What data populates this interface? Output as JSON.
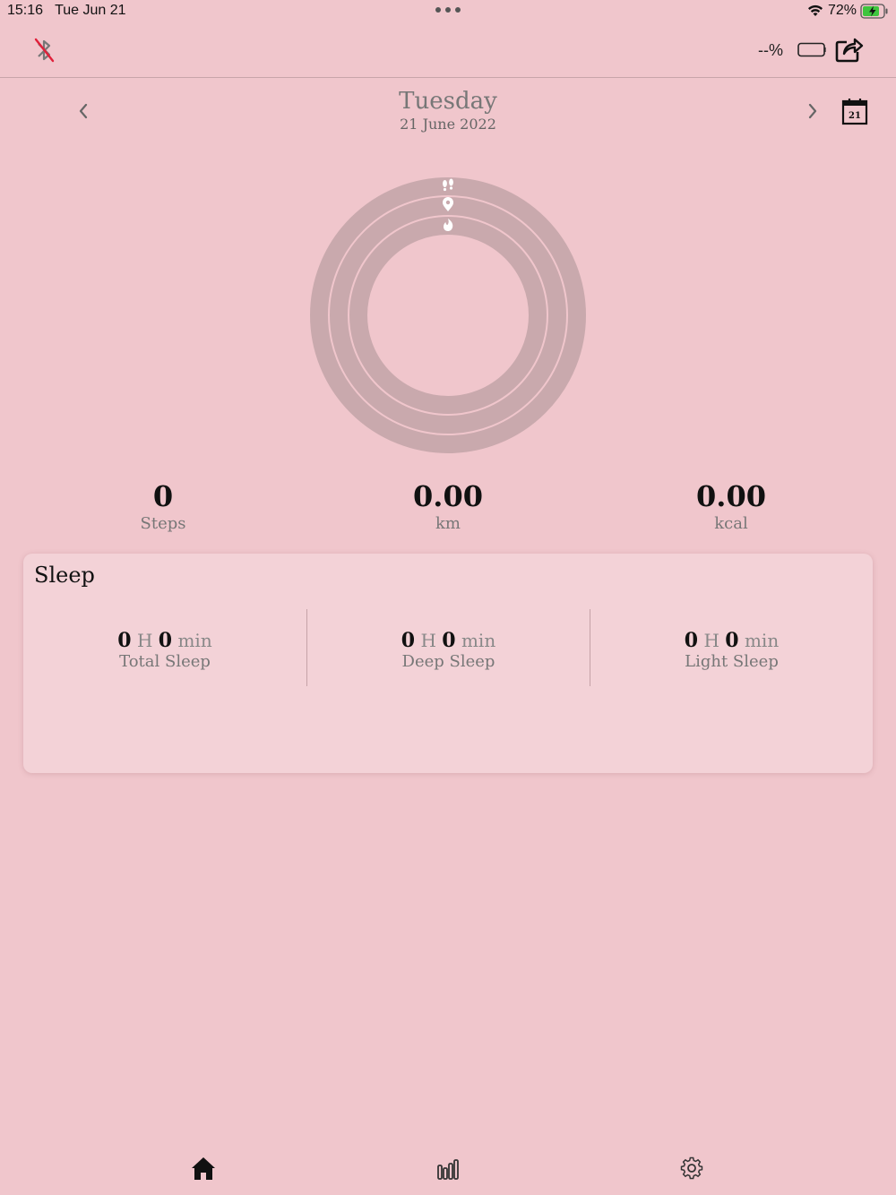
{
  "status_bar": {
    "time": "15:16",
    "date": "Tue Jun 21",
    "battery_pct": "72%"
  },
  "top_bar": {
    "device_battery_pct": "--%"
  },
  "date_nav": {
    "day_name": "Tuesday",
    "date_full": "21 June 2022",
    "calendar_day": "21"
  },
  "stats": {
    "steps": {
      "value": "0",
      "label": "Steps"
    },
    "distance": {
      "value": "0.00",
      "label": "km"
    },
    "calories": {
      "value": "0.00",
      "label": "kcal"
    }
  },
  "rings": {
    "steps_progress": 0,
    "distance_progress": 0,
    "calories_progress": 0
  },
  "sleep": {
    "title": "Sleep",
    "hours_unit": "H",
    "min_unit": "min",
    "total": {
      "hours": "0",
      "minutes": "0",
      "label": "Total Sleep"
    },
    "deep": {
      "hours": "0",
      "minutes": "0",
      "label": "Deep Sleep"
    },
    "light": {
      "hours": "0",
      "minutes": "0",
      "label": "Light Sleep"
    }
  },
  "tabs": [
    "home-icon",
    "stats-icon",
    "settings-icon"
  ],
  "colors": {
    "background": "#f0c6cc",
    "card": "#f3d2d7",
    "ring_track": "#c9a9ad",
    "bluetooth_off_slash": "#e0203a",
    "charging_green": "#3ec53e"
  }
}
